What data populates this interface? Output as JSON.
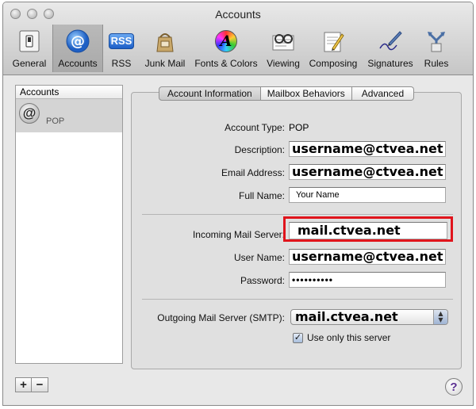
{
  "window": {
    "title": "Accounts"
  },
  "toolbar": {
    "items": [
      {
        "label": "General"
      },
      {
        "label": "Accounts"
      },
      {
        "label": "RSS"
      },
      {
        "label": "Junk Mail"
      },
      {
        "label": "Fonts & Colors"
      },
      {
        "label": "Viewing"
      },
      {
        "label": "Composing"
      },
      {
        "label": "Signatures"
      },
      {
        "label": "Rules"
      }
    ],
    "rss_badge": "RSS",
    "fonts_glyph": "A"
  },
  "sidebar": {
    "header": "Accounts",
    "accounts": [
      {
        "type": "POP",
        "icon": "at-sign-icon"
      }
    ],
    "add_label": "+",
    "remove_label": "−"
  },
  "tabs": [
    {
      "label": "Account Information",
      "selected": true
    },
    {
      "label": "Mailbox Behaviors",
      "selected": false
    },
    {
      "label": "Advanced",
      "selected": false
    }
  ],
  "form": {
    "account_type_label": "Account Type:",
    "account_type_value": "POP",
    "description_label": "Description:",
    "description_value": "username@ctvea.net",
    "email_label": "Email Address:",
    "email_value": "username@ctvea.net",
    "full_name_label": "Full Name:",
    "full_name_value": "Your Name",
    "incoming_label": "Incoming Mail Server:",
    "incoming_value": "mail.ctvea.net",
    "user_name_label": "User Name:",
    "user_name_value": "username@ctvea.net",
    "password_label": "Password:",
    "password_value": "••••••••••",
    "smtp_label": "Outgoing Mail Server (SMTP):",
    "smtp_value": "mail.ctvea.net",
    "use_only_label": "Use only this server",
    "use_only_checked": true
  },
  "help_label": "?",
  "colors": {
    "highlight": "#e0141c",
    "selected_tab": "#c8c8c8"
  }
}
